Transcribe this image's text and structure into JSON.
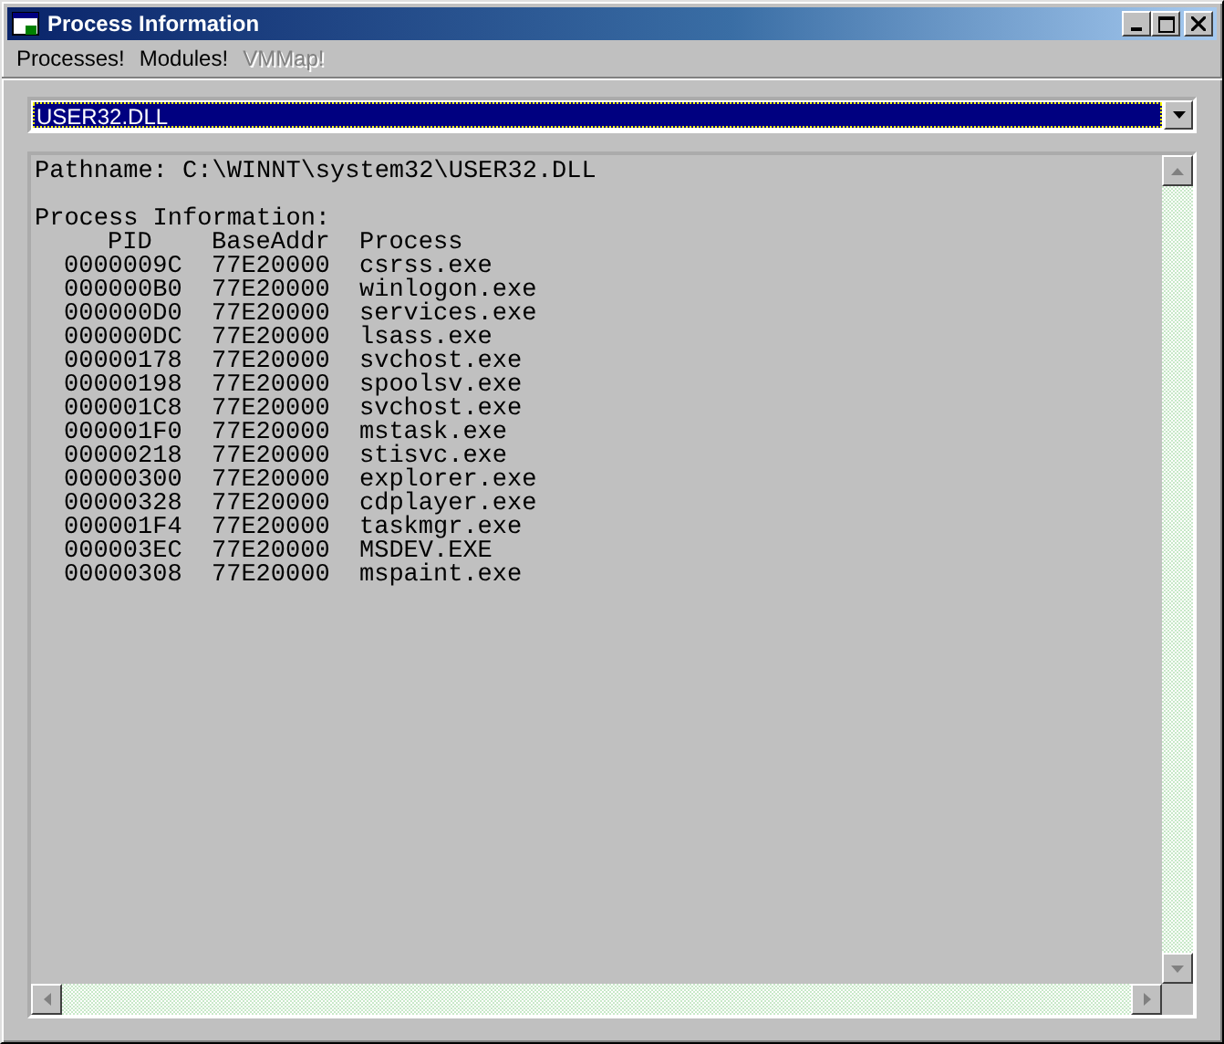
{
  "window": {
    "title": "Process Information"
  },
  "menu": [
    {
      "label": "Processes!",
      "disabled": false
    },
    {
      "label": "Modules!",
      "disabled": false
    },
    {
      "label": "VMMap!",
      "disabled": true
    }
  ],
  "module_combo": {
    "value": "USER32.DLL"
  },
  "output": {
    "pathname": "Pathname: C:\\WINNT\\system32\\USER32.DLL",
    "heading": "Process Information:",
    "columns": [
      "PID",
      "BaseAddr",
      "Process"
    ],
    "rows": [
      [
        "0000009C",
        "77E20000",
        "csrss.exe"
      ],
      [
        "000000B0",
        "77E20000",
        "winlogon.exe"
      ],
      [
        "000000D0",
        "77E20000",
        "services.exe"
      ],
      [
        "000000DC",
        "77E20000",
        "lsass.exe"
      ],
      [
        "00000178",
        "77E20000",
        "svchost.exe"
      ],
      [
        "00000198",
        "77E20000",
        "spoolsv.exe"
      ],
      [
        "000001C8",
        "77E20000",
        "svchost.exe"
      ],
      [
        "000001F0",
        "77E20000",
        "mstask.exe"
      ],
      [
        "00000218",
        "77E20000",
        "stisvc.exe"
      ],
      [
        "00000300",
        "77E20000",
        "explorer.exe"
      ],
      [
        "00000328",
        "77E20000",
        "cdplayer.exe"
      ],
      [
        "000001F4",
        "77E20000",
        "taskmgr.exe"
      ],
      [
        "000003EC",
        "77E20000",
        "MSDEV.EXE"
      ],
      [
        "00000308",
        "77E20000",
        "mspaint.exe"
      ]
    ]
  }
}
